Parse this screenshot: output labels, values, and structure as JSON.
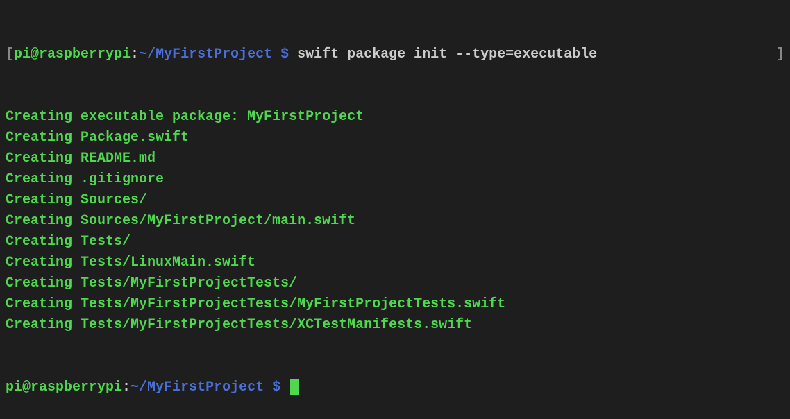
{
  "prompt1": {
    "left_bracket": "[",
    "user_host": "pi@raspberrypi",
    "colon": ":",
    "path": "~/MyFirstProject",
    "dollar": " $ ",
    "command": "swift package init --type=executable",
    "right_bracket": "]"
  },
  "output_lines": [
    "Creating executable package: MyFirstProject",
    "Creating Package.swift",
    "Creating README.md",
    "Creating .gitignore",
    "Creating Sources/",
    "Creating Sources/MyFirstProject/main.swift",
    "Creating Tests/",
    "Creating Tests/LinuxMain.swift",
    "Creating Tests/MyFirstProjectTests/",
    "Creating Tests/MyFirstProjectTests/MyFirstProjectTests.swift",
    "Creating Tests/MyFirstProjectTests/XCTestManifests.swift"
  ],
  "prompt2": {
    "user_host": "pi@raspberrypi",
    "colon": ":",
    "path": "~/MyFirstProject",
    "dollar": " $ "
  }
}
